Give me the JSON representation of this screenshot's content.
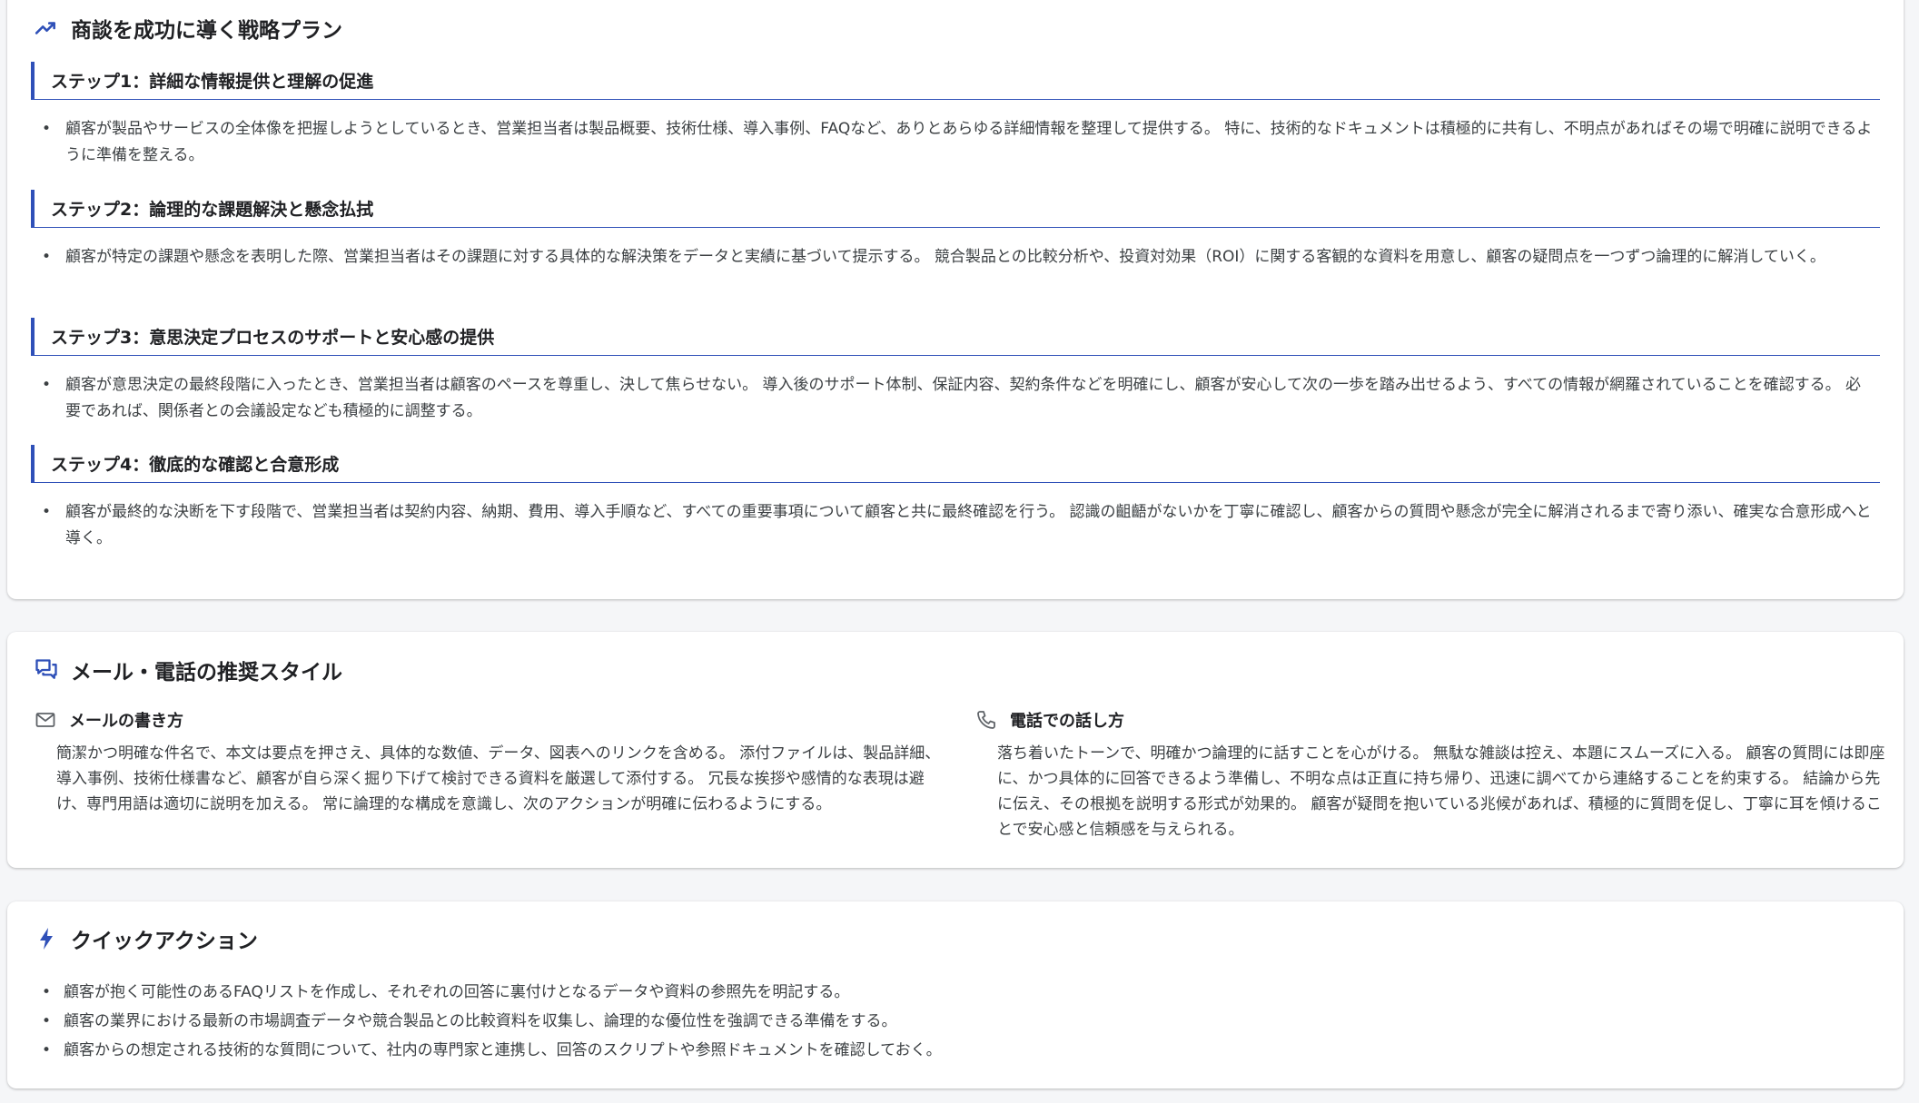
{
  "colors": {
    "accent": "#2f50b8",
    "text": "#202124",
    "body_text": "#3c4043",
    "card_bg": "#ffffff",
    "page_bg": "#f5f6f8"
  },
  "strategy": {
    "icon": "trending-up-icon",
    "title": "商談を成功に導く戦略プラン",
    "steps": [
      {
        "title": "ステップ1：詳細な情報提供と理解の促進",
        "text": "顧客が製品やサービスの全体像を把握しようとしているとき、営業担当者は製品概要、技術仕様、導入事例、FAQなど、ありとあらゆる詳細情報を整理して提供する。 特に、技術的なドキュメントは積極的に共有し、不明点があればその場で明確に説明できるように準備を整える。"
      },
      {
        "title": "ステップ2：論理的な課題解決と懸念払拭",
        "text": "顧客が特定の課題や懸念を表明した際、営業担当者はその課題に対する具体的な解決策をデータと実績に基づいて提示する。 競合製品との比較分析や、投資対効果（ROI）に関する客観的な資料を用意し、顧客の疑問点を一つずつ論理的に解消していく。"
      },
      {
        "title": "ステップ3：意思決定プロセスのサポートと安心感の提供",
        "text": "顧客が意思決定の最終段階に入ったとき、営業担当者は顧客のペースを尊重し、決して焦らせない。 導入後のサポート体制、保証内容、契約条件などを明確にし、顧客が安心して次の一歩を踏み出せるよう、すべての情報が網羅されていることを確認する。 必要であれば、関係者との会議設定なども積極的に調整する。"
      },
      {
        "title": "ステップ4：徹底的な確認と合意形成",
        "text": "顧客が最終的な決断を下す段階で、営業担当者は契約内容、納期、費用、導入手順など、すべての重要事項について顧客と共に最終確認を行う。 認識の齟齬がないかを丁寧に確認し、顧客からの質問や懸念が完全に解消されるまで寄り添い、確実な合意形成へと導く。"
      }
    ]
  },
  "style": {
    "icon": "chat-bubbles-icon",
    "title": "メール・電話の推奨スタイル",
    "email": {
      "icon": "mail-icon",
      "title": "メールの書き方",
      "text": "簡潔かつ明確な件名で、本文は要点を押さえ、具体的な数値、データ、図表へのリンクを含める。 添付ファイルは、製品詳細、導入事例、技術仕様書など、顧客が自ら深く掘り下げて検討できる資料を厳選して添付する。 冗長な挨拶や感情的な表現は避け、専門用語は適切に説明を加える。 常に論理的な構成を意識し、次のアクションが明確に伝わるようにする。"
    },
    "phone": {
      "icon": "phone-icon",
      "title": "電話での話し方",
      "text": "落ち着いたトーンで、明確かつ論理的に話すことを心がける。 無駄な雑談は控え、本題にスムーズに入る。 顧客の質問には即座に、かつ具体的に回答できるよう準備し、不明な点は正直に持ち帰り、迅速に調べてから連絡することを約束する。 結論から先に伝え、その根拠を説明する形式が効果的。 顧客が疑問を抱いている兆候があれば、積極的に質問を促し、丁寧に耳を傾けることで安心感と信頼感を与えられる。"
    }
  },
  "quick": {
    "icon": "lightning-icon",
    "title": "クイックアクション",
    "items": [
      "顧客が抱く可能性のあるFAQリストを作成し、それぞれの回答に裏付けとなるデータや資料の参照先を明記する。",
      "顧客の業界における最新の市場調査データや競合製品との比較資料を収集し、論理的な優位性を強調できる準備をする。",
      "顧客からの想定される技術的な質問について、社内の専門家と連携し、回答のスクリプトや参照ドキュメントを確認しておく。"
    ]
  }
}
